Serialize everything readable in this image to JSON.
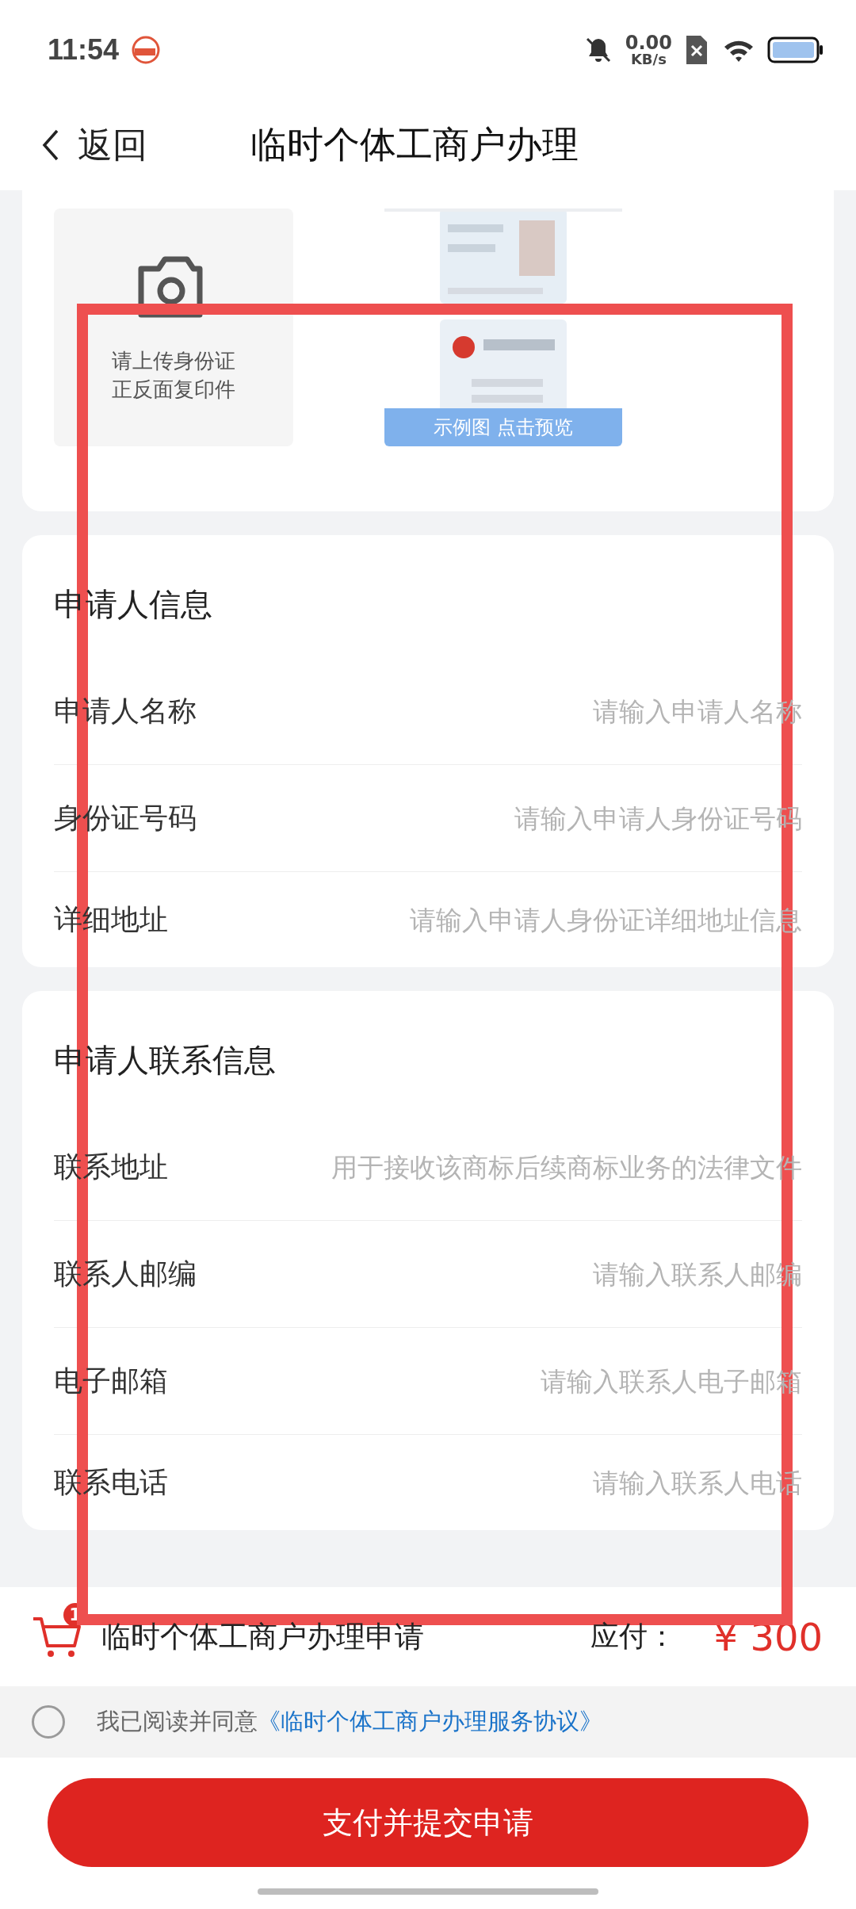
{
  "status_bar": {
    "time": "11:54",
    "speed": "0.00",
    "speed_unit": "KB/s"
  },
  "nav": {
    "back": "返回",
    "title": "临时个体工商户办理"
  },
  "upload": {
    "hint": [
      "请上传身份证",
      "正反面复印件"
    ],
    "sample": {
      "kind": "picture",
      "caption": "示例图 点击预览"
    }
  },
  "sections": [
    {
      "title": "申请人信息",
      "fields": [
        {
          "label": "申请人名称",
          "placeholder": "请输入申请人名称"
        },
        {
          "label": "身份证号码",
          "placeholder": "请输入申请人身份证号码"
        },
        {
          "label": "详细地址",
          "placeholder": "请输入申请人身份证详细地址信息"
        }
      ]
    },
    {
      "title": "申请人联系信息",
      "fields": [
        {
          "label": "联系地址",
          "placeholder": "用于接收该商标后续商标业务的法律文件"
        },
        {
          "label": "联系人邮编",
          "placeholder": "请输入联系人邮编"
        },
        {
          "label": "电子邮箱",
          "placeholder": "请输入联系人电子邮箱"
        },
        {
          "label": "联系电话",
          "placeholder": "请输入联系人电话"
        }
      ]
    }
  ],
  "order": {
    "cart_count": "1",
    "item": "临时个体工商户办理申请",
    "due_label": "应付：",
    "price": "¥ 300"
  },
  "agreement": {
    "checked": false,
    "text": "我已阅读并同意",
    "link": "《临时个体工商户办理服务协议》"
  },
  "submit_button": "支付并提交申请"
}
